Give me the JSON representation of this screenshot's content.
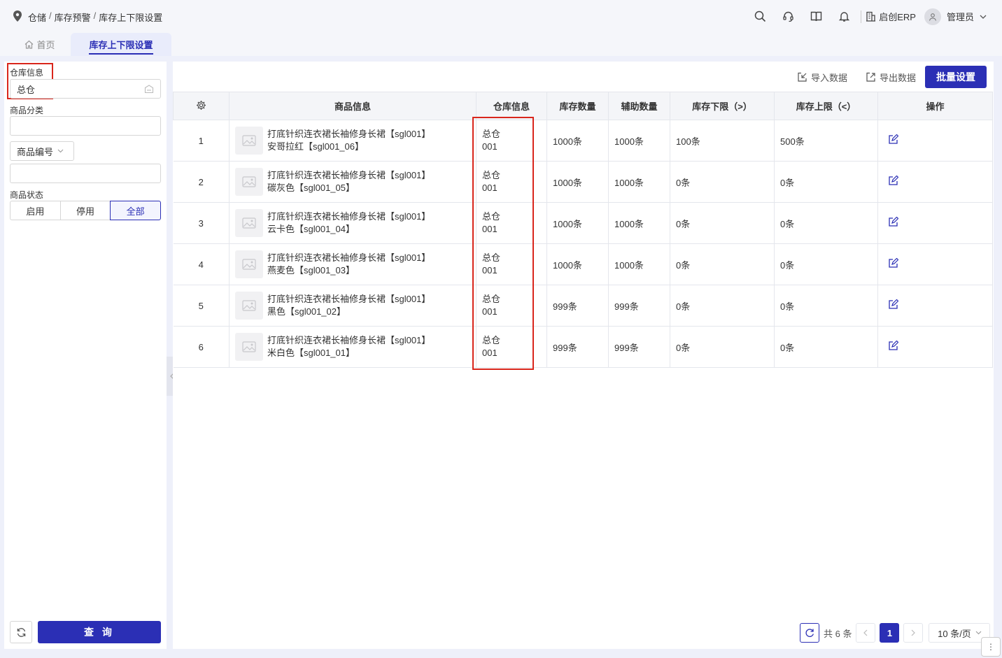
{
  "breadcrumb": [
    "仓储",
    "库存预警",
    "库存上下限设置"
  ],
  "header": {
    "brand": "启创ERP",
    "user": "管理员"
  },
  "tabs": {
    "home": "首页",
    "active": "库存上下限设置"
  },
  "filters": {
    "warehouse_label": "仓库信息",
    "warehouse_value": "总仓",
    "category_label": "商品分类",
    "code_select": "商品编号",
    "status_label": "商品状态",
    "status_options": [
      "启用",
      "停用",
      "全部"
    ],
    "status_selected": "全部",
    "query_label": "查 询"
  },
  "toolbar": {
    "import_label": "导入数据",
    "export_label": "导出数据",
    "batch_label": "批量设置"
  },
  "table": {
    "columns": [
      "商品信息",
      "仓库信息",
      "库存数量",
      "辅助数量",
      "库存下限（>）",
      "库存上限（<）",
      "操作"
    ],
    "rows": [
      {
        "no": "1",
        "name": "打底针织连衣裙长袖修身长裙【sgl001】",
        "variant": "安哥拉红【sgl001_06】",
        "wh": "总仓",
        "wh_code": "001",
        "qty": "1000条",
        "aux": "1000条",
        "min": "100条",
        "max": "500条"
      },
      {
        "no": "2",
        "name": "打底针织连衣裙长袖修身长裙【sgl001】",
        "variant": "碳灰色【sgl001_05】",
        "wh": "总仓",
        "wh_code": "001",
        "qty": "1000条",
        "aux": "1000条",
        "min": "0条",
        "max": "0条"
      },
      {
        "no": "3",
        "name": "打底针织连衣裙长袖修身长裙【sgl001】",
        "variant": "云卡色【sgl001_04】",
        "wh": "总仓",
        "wh_code": "001",
        "qty": "1000条",
        "aux": "1000条",
        "min": "0条",
        "max": "0条"
      },
      {
        "no": "4",
        "name": "打底针织连衣裙长袖修身长裙【sgl001】",
        "variant": "燕麦色【sgl001_03】",
        "wh": "总仓",
        "wh_code": "001",
        "qty": "1000条",
        "aux": "1000条",
        "min": "0条",
        "max": "0条"
      },
      {
        "no": "5",
        "name": "打底针织连衣裙长袖修身长裙【sgl001】",
        "variant": "黑色【sgl001_02】",
        "wh": "总仓",
        "wh_code": "001",
        "qty": "999条",
        "aux": "999条",
        "min": "0条",
        "max": "0条"
      },
      {
        "no": "6",
        "name": "打底针织连衣裙长袖修身长裙【sgl001】",
        "variant": "米白色【sgl001_01】",
        "wh": "总仓",
        "wh_code": "001",
        "qty": "999条",
        "aux": "999条",
        "min": "0条",
        "max": "0条"
      }
    ]
  },
  "pagination": {
    "total": "共 6 条",
    "current": "1",
    "page_size": "10 条/页"
  },
  "colors": {
    "primary": "#2b2fb5",
    "highlight": "#d9261c"
  }
}
